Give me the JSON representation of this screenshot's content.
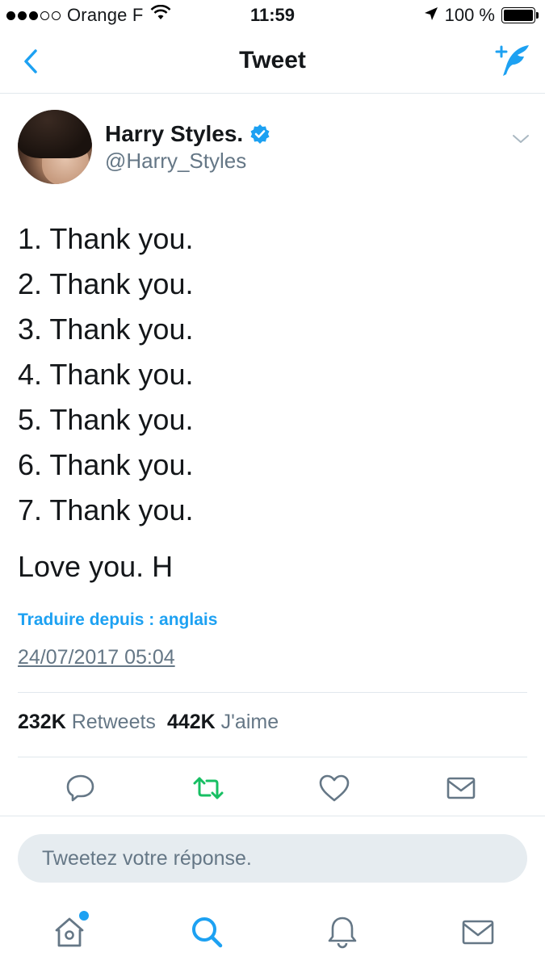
{
  "status_bar": {
    "carrier": "Orange F",
    "time": "11:59",
    "battery_percent": "100 %",
    "battery_level": 1.0
  },
  "nav": {
    "title": "Tweet",
    "back_icon": "chevron-left-icon",
    "compose_icon": "compose-tweet-icon"
  },
  "tweet": {
    "author": {
      "name": "Harry Styles.",
      "handle": "@Harry_Styles",
      "verified": true
    },
    "lines": [
      "1. Thank you.",
      "2. Thank you.",
      "3. Thank you.",
      "4. Thank you.",
      "5. Thank you.",
      "6. Thank you.",
      "7. Thank you."
    ],
    "signoff": "Love you. H",
    "translate_link": "Traduire depuis : anglais",
    "timestamp": "24/07/2017 05:04",
    "stats": {
      "retweets_count": "232K",
      "retweets_label": "Retweets",
      "likes_count": "442K",
      "likes_label": "J'aime"
    }
  },
  "reply": {
    "placeholder": "Tweetez votre réponse."
  },
  "colors": {
    "accent": "#1da1f2",
    "retweet_green": "#17bf63",
    "secondary_text": "#657786",
    "divider": "#e1e8ed",
    "icon_gray": "#657786"
  }
}
